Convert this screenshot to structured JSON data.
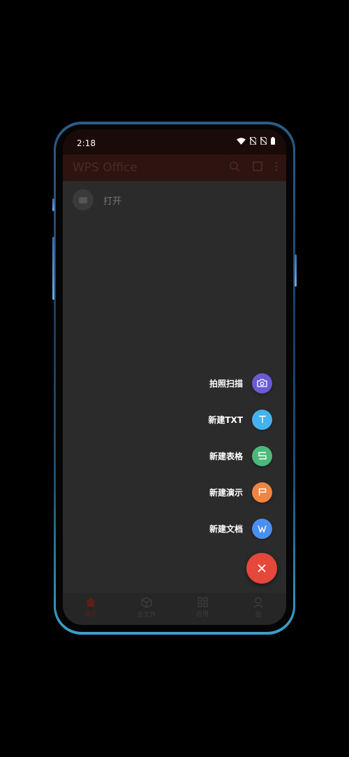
{
  "status_bar": {
    "time": "2:18"
  },
  "app_bar": {
    "title": "WPS Office"
  },
  "recent": {
    "open_label": "打开"
  },
  "fab_menu": {
    "items": [
      {
        "label": "拍照扫描",
        "color": "#6a5ad4",
        "icon": "camera-icon"
      },
      {
        "label": "新建TXT",
        "color": "#45b2f0",
        "icon": "txt-icon"
      },
      {
        "label": "新建表格",
        "color": "#4cb87a",
        "icon": "sheet-icon"
      },
      {
        "label": "新建演示",
        "color": "#ef8542",
        "icon": "presentation-icon"
      },
      {
        "label": "新建文档",
        "color": "#4a8ff0",
        "icon": "document-icon"
      }
    ],
    "close_color": "#e5483a"
  },
  "bottom_nav": {
    "items": [
      {
        "label": "最近",
        "icon": "home-icon",
        "active": true
      },
      {
        "label": "云文件",
        "icon": "cloud-box-icon",
        "active": false
      },
      {
        "label": "应用",
        "icon": "apps-grid-icon",
        "active": false
      },
      {
        "label": "我",
        "icon": "user-icon",
        "active": false
      }
    ]
  }
}
